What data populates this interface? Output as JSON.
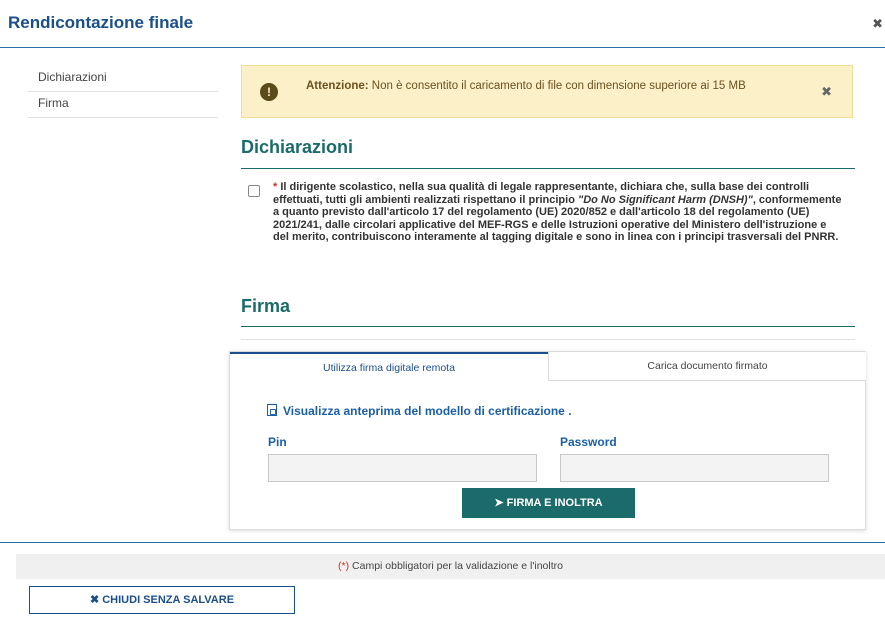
{
  "modal": {
    "title": "Rendicontazione finale",
    "close_icon": "✖"
  },
  "sidebar": {
    "items": [
      {
        "label": "Dichiarazioni"
      },
      {
        "label": "Firma"
      }
    ]
  },
  "alert": {
    "icon": "!",
    "bold_label": "Attenzione:",
    "message": " Non è consentito il caricamento di file con dimensione superiore ai 15 MB",
    "close_icon": "✖"
  },
  "declarations": {
    "title": "Dichiarazioni",
    "checked": false,
    "required_mark": "*",
    "text_part1": " Il dirigente scolastico, nella sua qualità di legale rappresentante, dichiara che, sulla base dei controlli effettuati, tutti gli ambienti realizzati rispettano il principio ",
    "text_italic": "\"Do No Significant Harm (DNSH)\"",
    "text_part2": ", conformemente a quanto previsto dall'articolo 17 del regolamento (UE) 2020/852 e dall'articolo 18 del regolamento (UE) 2021/241, dalle circolari applicative del MEF-RGS e delle Istruzioni operative del Ministero dell'istruzione e del merito, contribuiscono interamente al tagging digitale e sono in linea con i principi trasversali del PNRR."
  },
  "signature": {
    "title": "Firma",
    "tabs": [
      {
        "label": "Utilizza firma digitale remota",
        "active": true
      },
      {
        "label": "Carica documento firmato",
        "active": false
      }
    ],
    "preview_link": "Visualizza anteprima del modello di certificazione",
    "preview_suffix": " .",
    "pin_label": "Pin",
    "pin_value": "",
    "password_label": "Password",
    "password_value": "",
    "submit_label": "FIRMA E INOLTRA",
    "submit_icon": "➤"
  },
  "footer": {
    "required_mark": "(*)",
    "note": " Campi obbligatori per la validazione e l'inoltro",
    "close_label": "CHIUDI SENZA SALVARE",
    "close_icon": "✖"
  },
  "colors": {
    "primary_blue": "#1a4f8b",
    "teal": "#1b6b6b",
    "alert_bg": "#fcf0c9",
    "required_red": "#c0392b"
  }
}
